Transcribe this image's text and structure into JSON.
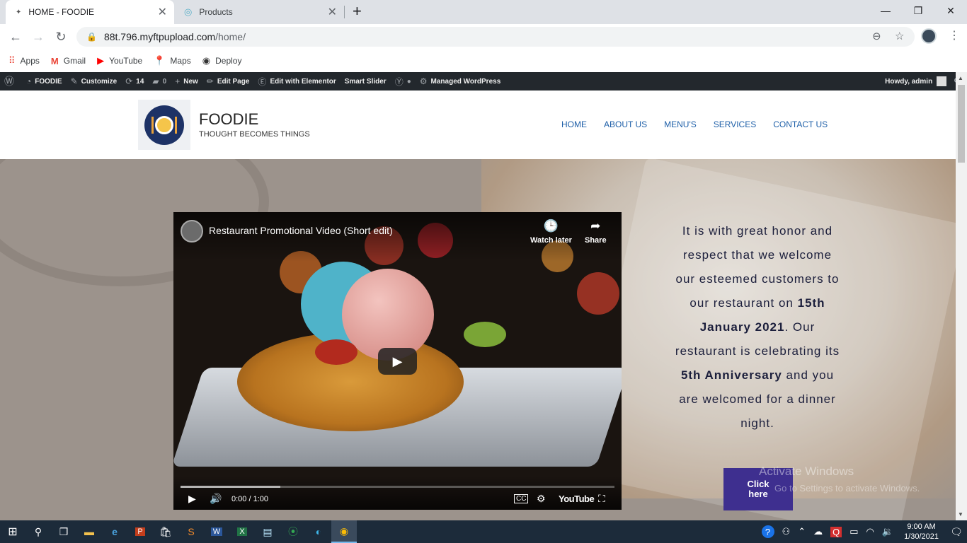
{
  "browser": {
    "tabs": [
      {
        "title": "HOME - FOODIE",
        "active": true
      },
      {
        "title": "Products",
        "active": false
      }
    ],
    "new_tab": "+",
    "window_controls": {
      "minimize": "—",
      "restore": "❐",
      "close": "✕"
    },
    "url_host": "88t.796.myftpupload.com",
    "url_path": "/home/",
    "bookmarks": [
      {
        "label": "Apps",
        "icon": "apps-grid-icon"
      },
      {
        "label": "Gmail",
        "icon": "gmail-icon"
      },
      {
        "label": "YouTube",
        "icon": "youtube-icon"
      },
      {
        "label": "Maps",
        "icon": "maps-icon"
      },
      {
        "label": "Deploy",
        "icon": "globe-icon"
      }
    ]
  },
  "wp_admin_bar": {
    "site": "FOODIE",
    "customize": "Customize",
    "updates": "14",
    "comments": "0",
    "new": "New",
    "edit_page": "Edit Page",
    "edit_elementor": "Edit with Elementor",
    "smart_slider": "Smart Slider",
    "managed_wp": "Managed WordPress",
    "howdy": "Howdy, admin"
  },
  "site": {
    "title": "FOODIE",
    "tagline": "THOUGHT BECOMES THINGS",
    "nav": [
      "HOME",
      "ABOUT US",
      "MENU'S",
      "SERVICES",
      "CONTACT US"
    ],
    "accent_color": "#1e5fa8"
  },
  "video": {
    "title": "Restaurant Promotional Video (Short edit)",
    "watch_later": "Watch later",
    "share": "Share",
    "time": "0:00 / 1:00",
    "brand": "YouTube",
    "buffered_fraction": 0.23
  },
  "welcome": {
    "part1": "It is with great honor and respect that we welcome our esteemed customers to our restaurant on ",
    "date": "15th January 2021",
    "part2": ". Our restaurant is celebrating its ",
    "anniversary": "5th Anniversary",
    "part3": " and you are welcomed for a dinner night.",
    "button": "Click here",
    "button_color": "#3e2f8f"
  },
  "watermark": {
    "line1": "Activate Windows",
    "line2": "Go to Settings to activate Windows."
  },
  "taskbar": {
    "time": "9:00 AM",
    "date": "1/30/2021"
  }
}
